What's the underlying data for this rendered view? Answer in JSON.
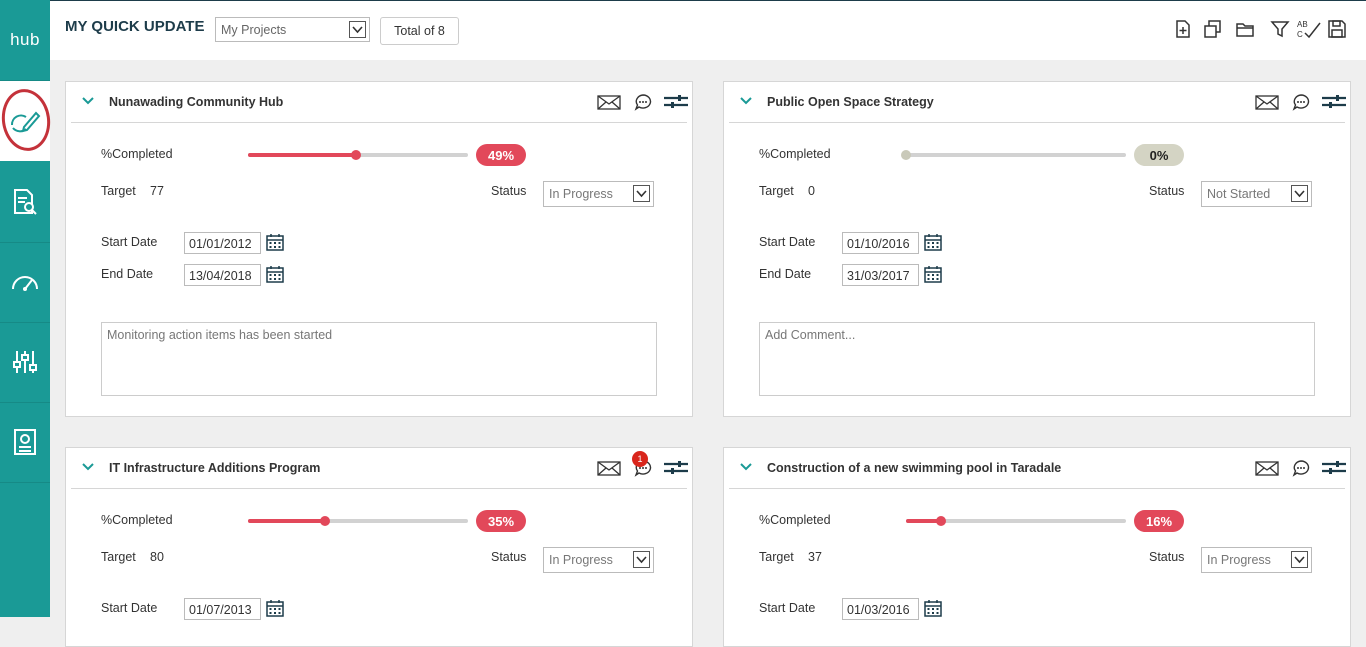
{
  "sidebar": {
    "logo": "hub",
    "items": [
      {
        "icon": "edit-refresh-icon"
      },
      {
        "icon": "document-search-icon"
      },
      {
        "icon": "gauge-icon"
      },
      {
        "icon": "equalizer-icon"
      },
      {
        "icon": "report-icon"
      }
    ]
  },
  "header": {
    "title": "MY QUICK UPDATE",
    "filter_value": "My Projects",
    "total_label": "Total of 8",
    "toolbar_icons": [
      "new-document-icon",
      "copy-icon",
      "folder-icon",
      "filter-icon",
      "spellcheck-icon",
      "save-icon"
    ]
  },
  "labels": {
    "completed": "%Completed",
    "target": "Target",
    "status": "Status",
    "start_date": "Start Date",
    "end_date": "End Date"
  },
  "projects": [
    {
      "title": "Nunawading Community Hub",
      "percent": 49,
      "percent_label": "49%",
      "target": "77",
      "status": "In Progress",
      "start_date": "01/01/2012",
      "end_date": "13/04/2018",
      "comment": "Monitoring action items has been started",
      "chat_badge": ""
    },
    {
      "title": "Public Open Space Strategy",
      "percent": 0,
      "percent_label": "0%",
      "target": "0",
      "status": "Not Started",
      "start_date": "01/10/2016",
      "end_date": "31/03/2017",
      "comment": "Add Comment...",
      "chat_badge": ""
    },
    {
      "title": "IT Infrastructure Additions Program",
      "percent": 35,
      "percent_label": "35%",
      "target": "80",
      "status": "In Progress",
      "start_date": "01/07/2013",
      "end_date": "",
      "comment": "",
      "chat_badge": "1"
    },
    {
      "title": "Construction of a new swimming pool in Taradale",
      "percent": 16,
      "percent_label": "16%",
      "target": "37",
      "status": "In Progress",
      "start_date": "01/03/2016",
      "end_date": "",
      "comment": "",
      "chat_badge": ""
    }
  ],
  "colors": {
    "teal": "#1a9a96",
    "accent_red": "#e2485a",
    "navy": "#1d3c4a"
  }
}
